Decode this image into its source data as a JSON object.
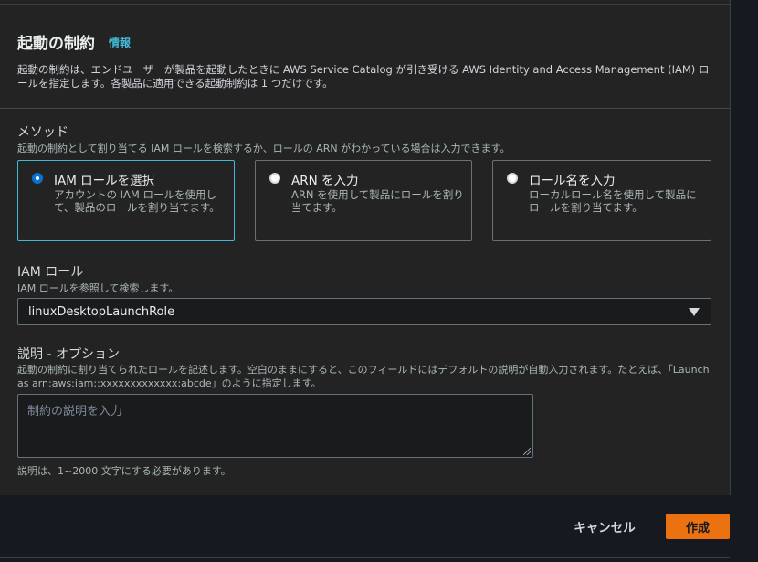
{
  "header": {
    "title": "起動の制約",
    "info": "情報",
    "description": "起動の制約は、エンドユーザーが製品を起動したときに AWS Service Catalog が引き受ける AWS Identity and Access Management (IAM) ロールを指定します。各製品に適用できる起動制約は 1 つだけです。"
  },
  "method": {
    "label": "メソッド",
    "hint": "起動の制約として割り当てる IAM ロールを検索するか、ロールの ARN がわかっている場合は入力できます。",
    "options": [
      {
        "title": "IAM ロールを選択",
        "description": "アカウントの IAM ロールを使用して、製品のロールを割り当てます。",
        "selected": true
      },
      {
        "title": "ARN を入力",
        "description": "ARN を使用して製品にロールを割り当てます。",
        "selected": false
      },
      {
        "title": "ロール名を入力",
        "description": "ローカルロール名を使用して製品にロールを割り当てます。",
        "selected": false
      }
    ]
  },
  "iam_role": {
    "label": "IAM ロール",
    "hint": "IAM ロールを参照して検索します。",
    "value": "linuxDesktopLaunchRole"
  },
  "description_field": {
    "label": "説明 - オプション",
    "hint": "起動の制約に割り当てられたロールを記述します。空白のままにすると、このフィールドにはデフォルトの説明が自動入力されます。たとえば、「Launch as arn:aws:iam::xxxxxxxxxxxxx:abcde」のように指定します。",
    "placeholder": "制約の説明を入力",
    "value": "",
    "constraint": "説明は、1~2000 文字にする必要があります。"
  },
  "footer": {
    "cancel": "キャンセル",
    "create": "作成"
  },
  "colors": {
    "accent": "#44b9d6",
    "primary_button": "#ec7211",
    "panel": "#232323",
    "background": "#16191f"
  }
}
